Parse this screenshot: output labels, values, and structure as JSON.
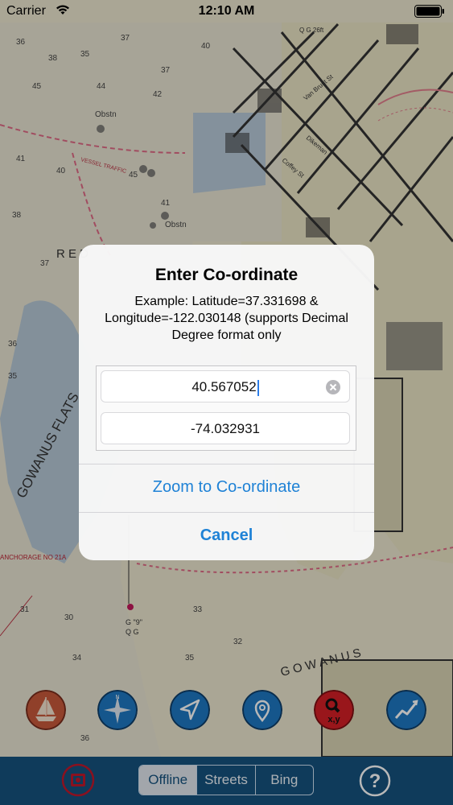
{
  "status_bar": {
    "carrier": "Carrier",
    "time": "12:10 AM",
    "icons": [
      "wifi-icon",
      "battery-icon"
    ]
  },
  "dialog": {
    "title": "Enter Co-ordinate",
    "message": "Example: Latitude=37.331698 & Longitude=-122.030148 (supports Decimal Degree format only",
    "latitude_value": "40.567052",
    "longitude_value": "-74.032931",
    "zoom_label": "Zoom to Co-ordinate",
    "cancel_label": "Cancel",
    "accent_color": "#1f82d6"
  },
  "toolbar_buttons": [
    "boat-icon",
    "compass-icon",
    "navigation-arrow-icon",
    "location-pin-icon",
    "search-xy-icon",
    "route-icon"
  ],
  "map_labels": {
    "gowanus_flats": "GOWANUS FLATS",
    "gowanus_bay": "G O W A N U S",
    "red_hook": "R E D",
    "anchorage": "ANCHORAGE NO 21A",
    "vessel": "VESSEL TRAFFIC",
    "beacon": "G \"9\"",
    "beacon2": "Q G",
    "depths": [
      "36",
      "38",
      "35",
      "37",
      "45",
      "44",
      "42",
      "41",
      "40",
      "38",
      "37",
      "36",
      "35",
      "31",
      "30",
      "34",
      "33",
      "32",
      "35",
      "37",
      "40",
      "45",
      "41",
      "36"
    ],
    "obstn": "Obstn",
    "street1": "Van Brunt St",
    "street2": "Coffey St",
    "street3": "Dikeman",
    "qg": "Q G 26ft"
  },
  "bottom_bar": {
    "segments": [
      "Offline",
      "Streets",
      "Bing"
    ],
    "selected": "Offline",
    "help_label": "?",
    "bar_color": "#15527f"
  }
}
